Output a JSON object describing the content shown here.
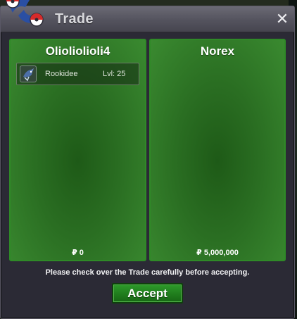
{
  "window": {
    "title": "Trade",
    "close_symbol": "✕"
  },
  "trade": {
    "left_player": {
      "name": "Olioliolioli4",
      "money": "₽ 0",
      "pokemon": [
        {
          "name": "Rookidee",
          "level": "Lvl: 25",
          "icon": "rookidee-sprite-icon"
        }
      ]
    },
    "right_player": {
      "name": "Norex",
      "money": "₽ 5,000,000"
    }
  },
  "footer": {
    "notice": "Please check over the Trade carefully before accepting.",
    "accept_label": "Accept"
  },
  "colors": {
    "panel_green": "#2a6e22",
    "panel_border": "#2f8a27",
    "window_bg": "#2b2a35",
    "titlebar": "#54535e",
    "accept_button": "#1f7a1c"
  }
}
